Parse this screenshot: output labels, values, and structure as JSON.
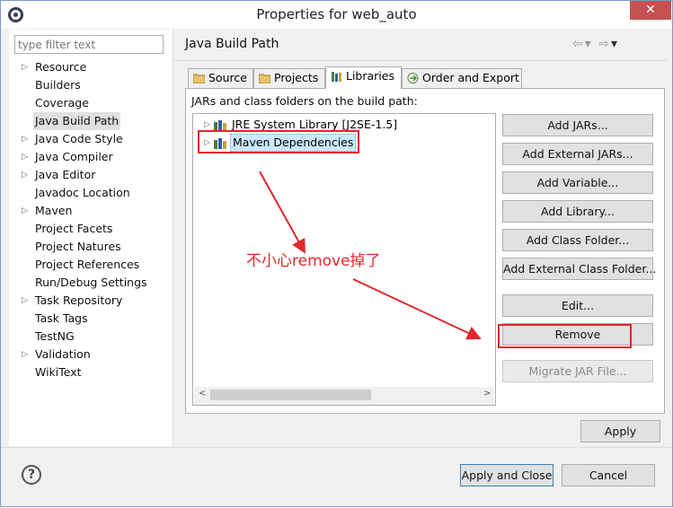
{
  "window": {
    "title": "Properties for web_auto",
    "close_label": "✕"
  },
  "filter": {
    "placeholder": "type filter text"
  },
  "sidebar": {
    "items": [
      {
        "label": "Resource",
        "expandable": true
      },
      {
        "label": "Builders",
        "expandable": false
      },
      {
        "label": "Coverage",
        "expandable": false
      },
      {
        "label": "Java Build Path",
        "expandable": false,
        "selected": true
      },
      {
        "label": "Java Code Style",
        "expandable": true
      },
      {
        "label": "Java Compiler",
        "expandable": true
      },
      {
        "label": "Java Editor",
        "expandable": true
      },
      {
        "label": "Javadoc Location",
        "expandable": false
      },
      {
        "label": "Maven",
        "expandable": true
      },
      {
        "label": "Project Facets",
        "expandable": false
      },
      {
        "label": "Project Natures",
        "expandable": false
      },
      {
        "label": "Project References",
        "expandable": false
      },
      {
        "label": "Run/Debug Settings",
        "expandable": false
      },
      {
        "label": "Task Repository",
        "expandable": true
      },
      {
        "label": "Task Tags",
        "expandable": false
      },
      {
        "label": "TestNG",
        "expandable": false
      },
      {
        "label": "Validation",
        "expandable": true
      },
      {
        "label": "WikiText",
        "expandable": false
      }
    ]
  },
  "page": {
    "title": "Java Build Path"
  },
  "tabs": [
    {
      "label": "Source",
      "icon": "source-folder-icon"
    },
    {
      "label": "Projects",
      "icon": "projects-folder-icon"
    },
    {
      "label": "Libraries",
      "icon": "libraries-icon",
      "active": true
    },
    {
      "label": "Order and Export",
      "icon": "order-export-icon"
    }
  ],
  "libraries": {
    "label": "JARs and class folders on the build path:",
    "entries": [
      {
        "label": "JRE System Library [J2SE-1.5]"
      },
      {
        "label": "Maven Dependencies",
        "selected": true
      }
    ]
  },
  "buttons": {
    "add_jars": "Add JARs...",
    "add_external_jars": "Add External JARs...",
    "add_variable": "Add Variable...",
    "add_library": "Add Library...",
    "add_class_folder": "Add Class Folder...",
    "add_external_class_folder": "Add External Class Folder...",
    "edit": "Edit...",
    "remove": "Remove",
    "migrate_jar": "Migrate JAR File...",
    "apply": "Apply",
    "apply_and_close": "Apply and Close",
    "cancel": "Cancel"
  },
  "annotation": {
    "text": "不小心remove掉了",
    "color": "#e0282c"
  },
  "help": {
    "glyph": "?"
  }
}
